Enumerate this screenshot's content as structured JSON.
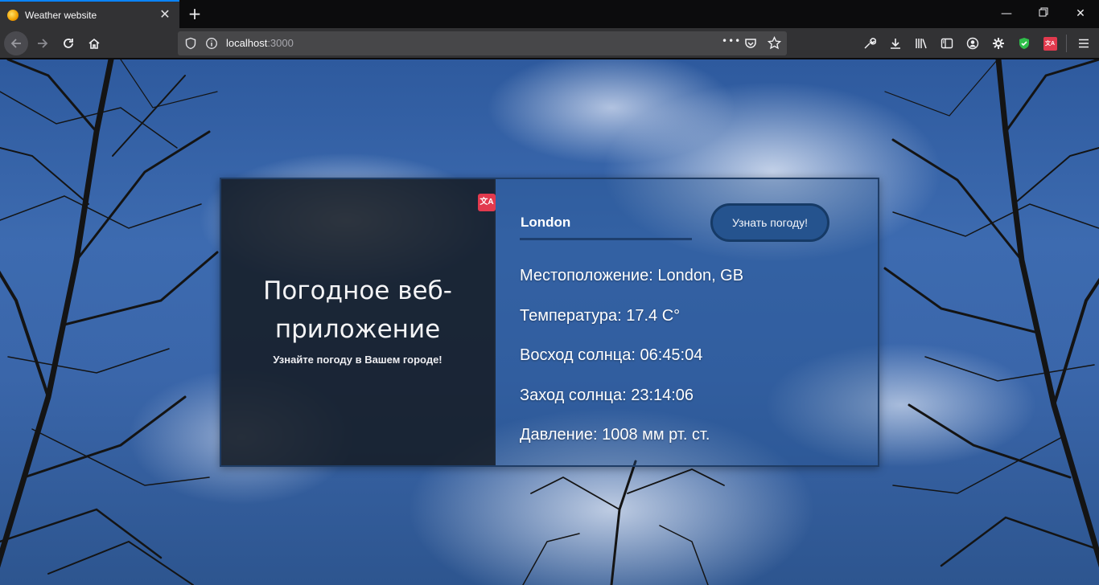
{
  "browser": {
    "tab_title": "Weather website",
    "new_tab": "+",
    "url_host": "localhost",
    "url_port": ":3000",
    "page_actions": "•••"
  },
  "page": {
    "title": "Погодное веб-приложение",
    "subtitle": "Узнайте погоду в Вашем городе!",
    "translate_badge": "文A",
    "city_value": "London",
    "button_label": "Узнать погоду!",
    "info": [
      "Местоположение: London, GB",
      "Температура: 17.4 C°",
      "Восход солнца: 06:45:04",
      "Заход солнца: 23:14:06",
      "Давление: 1008 мм рт. ст."
    ]
  },
  "colors": {
    "accent": "#0a84ff",
    "button": "#25538e",
    "card_border": "#1f3d66"
  }
}
